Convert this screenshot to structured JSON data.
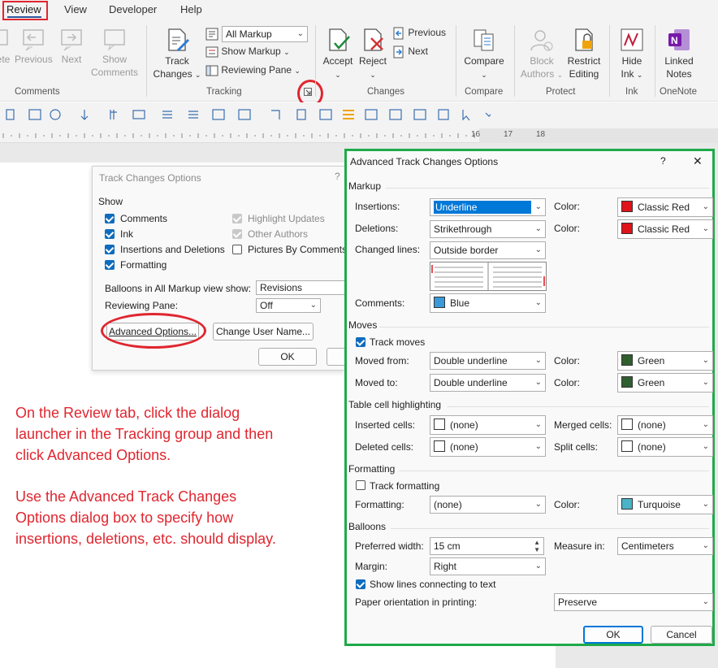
{
  "tabs": {
    "review": "Review",
    "view": "View",
    "developer": "Developer",
    "help": "Help"
  },
  "ribbon": {
    "comments": {
      "delete": "ete",
      "previous": "Previous",
      "next": "Next",
      "show_line1": "Show",
      "show_line2": "Comments",
      "group": "Comments"
    },
    "tracking": {
      "track_line1": "Track",
      "track_line2": "Changes",
      "markup_select": "All Markup",
      "show_markup": "Show Markup",
      "reviewing_pane": "Reviewing Pane",
      "group": "Tracking"
    },
    "changes": {
      "accept": "Accept",
      "reject": "Reject",
      "previous": "Previous",
      "next": "Next",
      "group": "Changes"
    },
    "compare": {
      "compare": "Compare",
      "group": "Compare"
    },
    "protect": {
      "block_line1": "Block",
      "block_line2": "Authors",
      "restrict_line1": "Restrict",
      "restrict_line2": "Editing",
      "group": "Protect"
    },
    "ink": {
      "hide_line1": "Hide",
      "hide_line2": "Ink",
      "group": "Ink"
    },
    "onenote": {
      "linked_line1": "Linked",
      "linked_line2": "Notes",
      "group": "OneNote"
    }
  },
  "ruler": {
    "marks": [
      "16",
      "17",
      "18"
    ]
  },
  "track_changes_options": {
    "title": "Track Changes Options",
    "help": "?",
    "show_label": "Show",
    "comments": "Comments",
    "ink": "Ink",
    "insertions_deletions": "Insertions and Deletions",
    "formatting": "Formatting",
    "highlight_updates": "Highlight Updates",
    "other_authors": "Other Authors",
    "pictures_by_comments": "Pictures By Comments",
    "balloons_label": "Balloons in All Markup view show:",
    "balloons_value": "Revisions",
    "reviewing_pane_label": "Reviewing Pane:",
    "reviewing_pane_value": "Off",
    "advanced_button": "Advanced Options...",
    "change_user_button": "Change User Name...",
    "ok": "OK"
  },
  "instructions": {
    "line1": "On the Review tab, click the dialog",
    "line2": "launcher in the Tracking group and then",
    "line3": "click Advanced Options.",
    "line4": "Use the Advanced Track  Changes",
    "line5": "Options dialog box to specify how",
    "line6": "insertions, deletions, etc. should display."
  },
  "advanced": {
    "title": "Advanced Track Changes Options",
    "help": "?",
    "close": "✕",
    "markup": {
      "heading": "Markup",
      "insertions_label": "Insertions:",
      "insertions_value": "Underline",
      "insertions_color_label": "Color:",
      "insertions_color": "Classic Red",
      "deletions_label": "Deletions:",
      "deletions_value": "Strikethrough",
      "deletions_color_label": "Color:",
      "deletions_color": "Classic Red",
      "changed_lines_label": "Changed lines:",
      "changed_lines_value": "Outside border",
      "comments_label": "Comments:",
      "comments_color": "Blue"
    },
    "moves": {
      "heading": "Moves",
      "track_moves": "Track moves",
      "moved_from_label": "Moved from:",
      "moved_from_value": "Double underline",
      "moved_from_color_label": "Color:",
      "moved_from_color": "Green",
      "moved_to_label": "Moved to:",
      "moved_to_value": "Double underline",
      "moved_to_color_label": "Color:",
      "moved_to_color": "Green"
    },
    "table": {
      "heading": "Table cell highlighting",
      "inserted_label": "Inserted cells:",
      "inserted_value": "(none)",
      "merged_label": "Merged cells:",
      "merged_value": "(none)",
      "deleted_label": "Deleted cells:",
      "deleted_value": "(none)",
      "split_label": "Split cells:",
      "split_value": "(none)"
    },
    "formatting": {
      "heading": "Formatting",
      "track_formatting": "Track formatting",
      "formatting_label": "Formatting:",
      "formatting_value": "(none)",
      "color_label": "Color:",
      "color_value": "Turquoise"
    },
    "balloons": {
      "heading": "Balloons",
      "preferred_width_label": "Preferred width:",
      "preferred_width_value": "15 cm",
      "measure_label": "Measure in:",
      "measure_value": "Centimeters",
      "margin_label": "Margin:",
      "margin_value": "Right",
      "show_lines": "Show lines connecting to text",
      "paper_label": "Paper orientation in printing:",
      "paper_value": "Preserve"
    },
    "ok": "OK",
    "cancel": "Cancel"
  },
  "colors": {
    "annotation_red": "#e0262f",
    "highlight_green": "#1faa4a",
    "classic_red": "#e0121a",
    "blue": "#3a9ad9",
    "green": "#2f5f2f",
    "turquoise": "#4bb3c8",
    "checkbox_blue": "#0f6cbd"
  }
}
